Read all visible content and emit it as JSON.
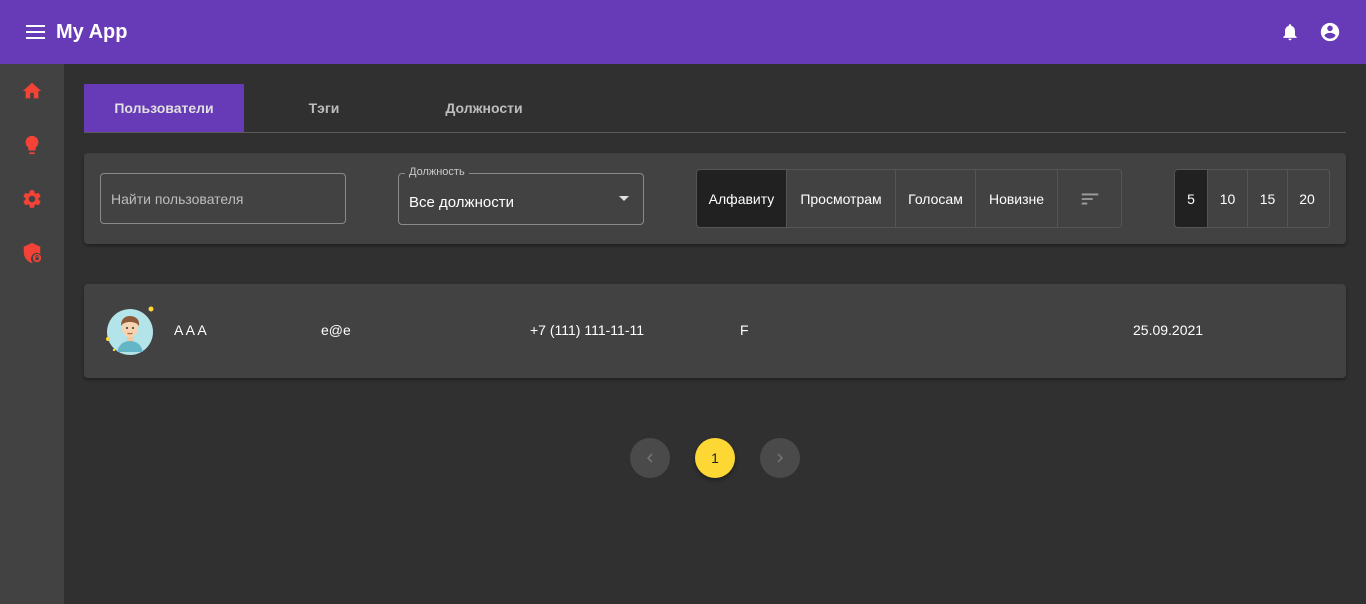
{
  "app": {
    "title": "My App"
  },
  "appbar_icons": [
    "menu-icon",
    "bell-icon",
    "account-circle-icon"
  ],
  "sidebar": {
    "items": [
      {
        "icon": "home-icon"
      },
      {
        "icon": "lightbulb-icon"
      },
      {
        "icon": "gear-icon"
      },
      {
        "icon": "security-shield-icon"
      }
    ]
  },
  "tabs": [
    {
      "label": "Пользователи",
      "active": true
    },
    {
      "label": "Тэги",
      "active": false
    },
    {
      "label": "Должности",
      "active": false
    }
  ],
  "search": {
    "placeholder": "Найти пользователя",
    "value": ""
  },
  "position_select": {
    "label": "Должность",
    "value": "Все должности"
  },
  "sort": {
    "options": [
      "Алфавиту",
      "Просмотрам",
      "Голосам",
      "Новизне"
    ],
    "active": "Алфавиту",
    "direction_icon": "sort-icon"
  },
  "page_size": {
    "options": [
      "5",
      "10",
      "15",
      "20"
    ],
    "active": "5"
  },
  "users": [
    {
      "name": "A A A",
      "email": "e@e",
      "phone": "+7 (111) 111-11-11",
      "position": "F",
      "date": "25.09.2021"
    }
  ],
  "pagination": {
    "current": "1"
  },
  "colors": {
    "accent": "#673ab7",
    "icon_red": "#f44336",
    "page_active": "#fdd835",
    "background": "#303030",
    "surface": "#424242"
  }
}
